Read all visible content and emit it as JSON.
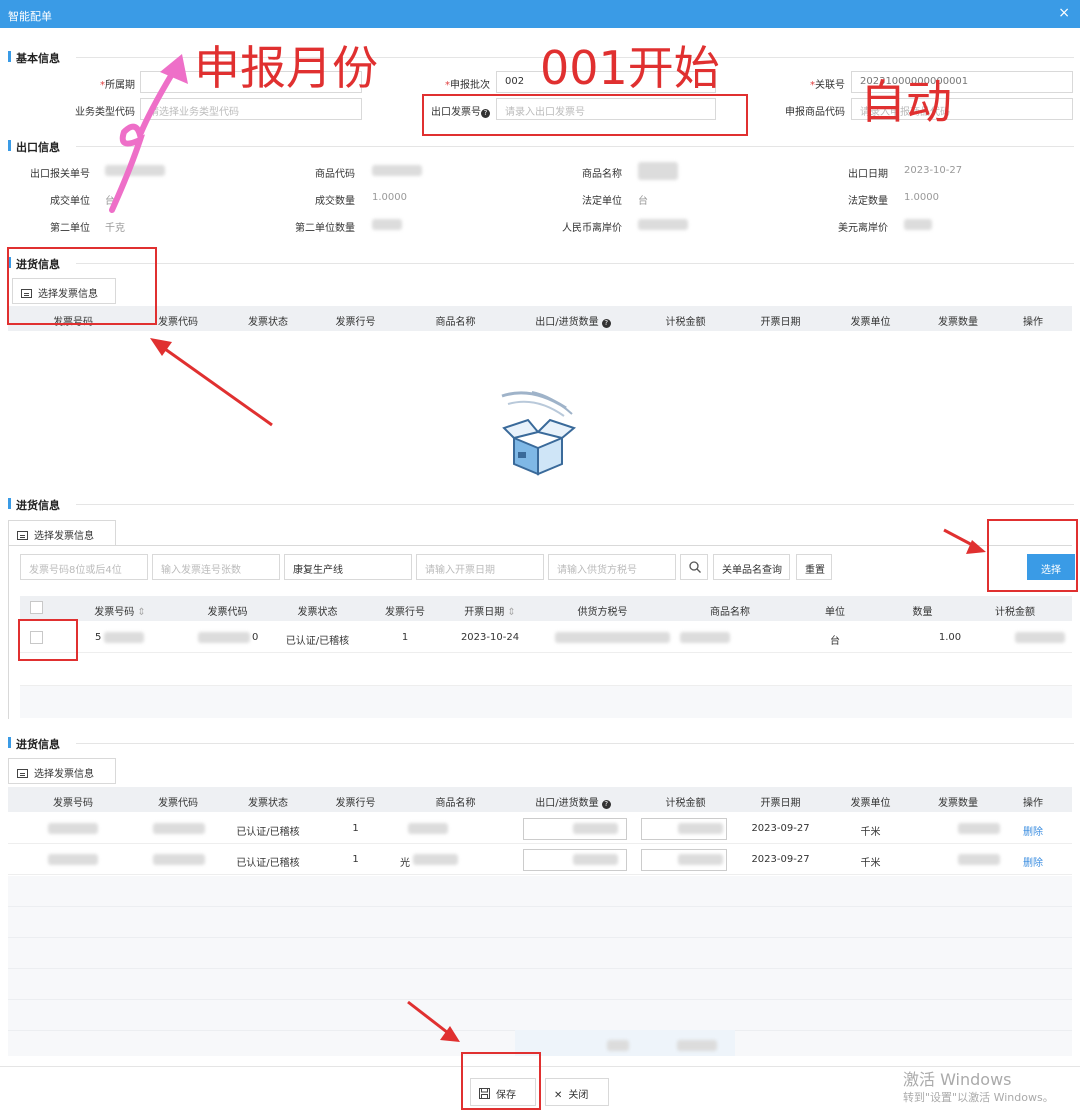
{
  "window": {
    "title": "智能配单",
    "close": "×"
  },
  "basic": {
    "section": "基本信息",
    "period_label": "所属期",
    "batch_label": "申报批次",
    "batch_value": "002",
    "link_label": "关联号",
    "link_value": "20231000000000001",
    "biz_type_label": "业务类型代码",
    "biz_type_placeholder": "请选择业务类型代码",
    "export_invoice_label": "出口发票号",
    "export_invoice_placeholder": "请录入出口发票号",
    "goods_code_label": "申报商品代码",
    "goods_code_placeholder": "请录入申报商品代码"
  },
  "export": {
    "section": "出口信息",
    "customs_no_label": "出口报关单号",
    "goods_code_label": "商品代码",
    "goods_name_label": "商品名称",
    "export_date_label": "出口日期",
    "export_date_value": "2023-10-27",
    "deal_unit_label": "成交单位",
    "deal_unit_value": "台",
    "deal_qty_label": "成交数量",
    "deal_qty_value": "1.0000",
    "legal_unit_label": "法定单位",
    "legal_unit_value": "台",
    "legal_qty_label": "法定数量",
    "legal_qty_value": "1.0000",
    "second_unit_label": "第二单位",
    "second_unit_value": "千克",
    "second_qty_label": "第二单位数量",
    "rmb_price_label": "人民币离岸价",
    "usd_price_label": "美元离岸价"
  },
  "purchase1": {
    "section": "进货信息",
    "select_btn": "选择发票信息",
    "columns": [
      "发票号码",
      "发票代码",
      "发票状态",
      "发票行号",
      "商品名称",
      "出口/进货数量",
      "计税金额",
      "开票日期",
      "发票单位",
      "发票数量",
      "操作"
    ]
  },
  "purchase2": {
    "section": "进货信息",
    "tab": "选择发票信息",
    "filter_invoice_ph": "发票号码8位或后4位",
    "filter_count_ph": "输入发票连号张数",
    "filter_line_value": "康复生产线",
    "filter_date_ph": "请输入开票日期",
    "filter_tax_ph": "请输入供货方税号",
    "query_btn": "关单品名查询",
    "reset_btn": "重置",
    "select_btn": "选择",
    "columns": [
      "发票号码",
      "发票代码",
      "发票状态",
      "发票行号",
      "开票日期",
      "供货方税号",
      "商品名称",
      "单位",
      "数量",
      "计税金额"
    ],
    "row": {
      "invoice_no": "5",
      "code": "0",
      "status": "已认证/已稽核",
      "line": "1",
      "date": "2023-10-24",
      "unit": "台",
      "qty": "1.00"
    }
  },
  "purchase3": {
    "section": "进货信息",
    "select_btn": "选择发票信息",
    "columns": [
      "发票号码",
      "发票代码",
      "发票状态",
      "发票行号",
      "商品名称",
      "出口/进货数量",
      "计税金额",
      "开票日期",
      "发票单位",
      "发票数量",
      "操作"
    ],
    "rows": [
      {
        "status": "已认证/已稽核",
        "line": "1",
        "name": "",
        "date": "2023-09-27",
        "unit": "千米",
        "op": "删除"
      },
      {
        "status": "已认证/已稽核",
        "line": "1",
        "name": "光",
        "date": "2023-09-27",
        "unit": "千米",
        "op": "删除"
      }
    ]
  },
  "footer": {
    "save": "保存",
    "close": "关闭"
  },
  "annotations": {
    "month": "申报月份",
    "start": "001开始",
    "auto": "自动"
  },
  "watermark": {
    "line1": "激活 Windows",
    "line2": "转到\"设置\"以激活 Windows。"
  },
  "colors": {
    "accent": "#3a9be6",
    "annotation": "#e03030",
    "arrow_pink": "#ee6fc8"
  }
}
